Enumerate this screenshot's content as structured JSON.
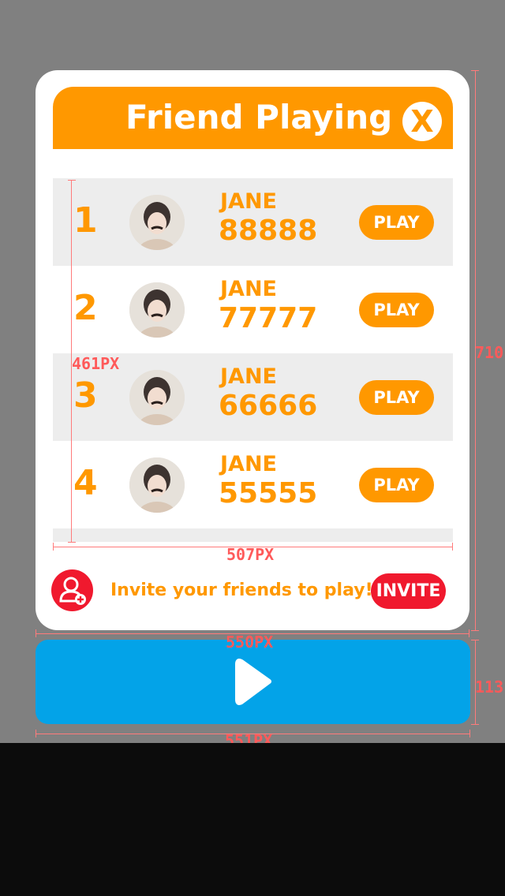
{
  "dialog": {
    "title": "Friend Playing",
    "close_glyph": "X",
    "close_icon": "close-icon"
  },
  "players": [
    {
      "rank": "1",
      "name": "JANE",
      "score": "88888",
      "play_label": "PLAY"
    },
    {
      "rank": "2",
      "name": "JANE",
      "score": "77777",
      "play_label": "PLAY"
    },
    {
      "rank": "3",
      "name": "JANE",
      "score": "66666",
      "play_label": "PLAY"
    },
    {
      "rank": "4",
      "name": "JANE",
      "score": "55555",
      "play_label": "PLAY"
    }
  ],
  "invite": {
    "text": "Invite your friends to play!",
    "button_label": "INVITE",
    "icon": "add-user-icon"
  },
  "play_bar": {
    "icon": "play-icon"
  },
  "annotations": {
    "list_height": "461PX",
    "list_width": "507PX",
    "panel_width": "550PX",
    "panel_height": "710",
    "bar_width": "551PX",
    "bar_height": "113"
  },
  "colors": {
    "orange": "#ff9800",
    "red": "#f0192e",
    "blue": "#03a3e8",
    "background": "#808080",
    "annotation": "#ff5a5a"
  }
}
